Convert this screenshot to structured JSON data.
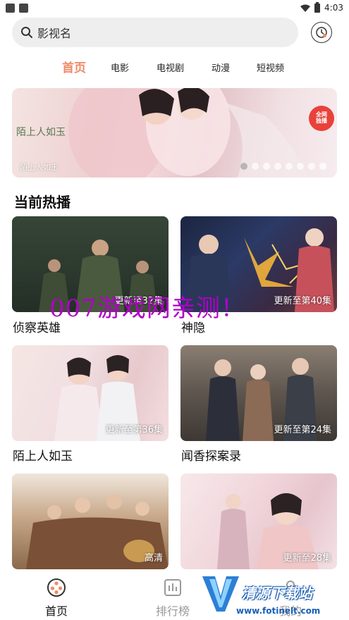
{
  "status_bar": {
    "time": "4:03"
  },
  "search": {
    "placeholder": "影视名"
  },
  "tabs": [
    {
      "label": "首页",
      "active": true
    },
    {
      "label": "电影",
      "active": false
    },
    {
      "label": "电视剧",
      "active": false
    },
    {
      "label": "动漫",
      "active": false
    },
    {
      "label": "短视频",
      "active": false
    }
  ],
  "banner": {
    "caption": "陌上人如玉",
    "logo_text": "陌上人如玉",
    "badge_line1": "全网",
    "badge_line2": "独播",
    "slide_count": 8,
    "active_slide": 1
  },
  "section": {
    "title": "当前热播"
  },
  "cards": [
    {
      "title": "侦察英雄",
      "status": "更新至32集"
    },
    {
      "title": "神隐",
      "status": "更新至第40集"
    },
    {
      "title": "陌上人如玉",
      "status": "更新至第36集"
    },
    {
      "title": "闻香探案录",
      "status": "更新至第24集"
    },
    {
      "title": "",
      "status": "高清"
    },
    {
      "title": "",
      "status": "更新至28集"
    }
  ],
  "watermark": "007游戏网亲测！",
  "bottom_nav": [
    {
      "label": "首页",
      "active": true,
      "icon": "film-reel-icon"
    },
    {
      "label": "排行榜",
      "active": false,
      "icon": "chart-icon"
    },
    {
      "label": "我的",
      "active": false,
      "icon": "user-icon"
    }
  ],
  "corner_logo": {
    "text": "清源下载站",
    "url": "www.fotinelt.com"
  },
  "colors": {
    "accent": "#f08a67",
    "watermark": "#b000c8"
  }
}
